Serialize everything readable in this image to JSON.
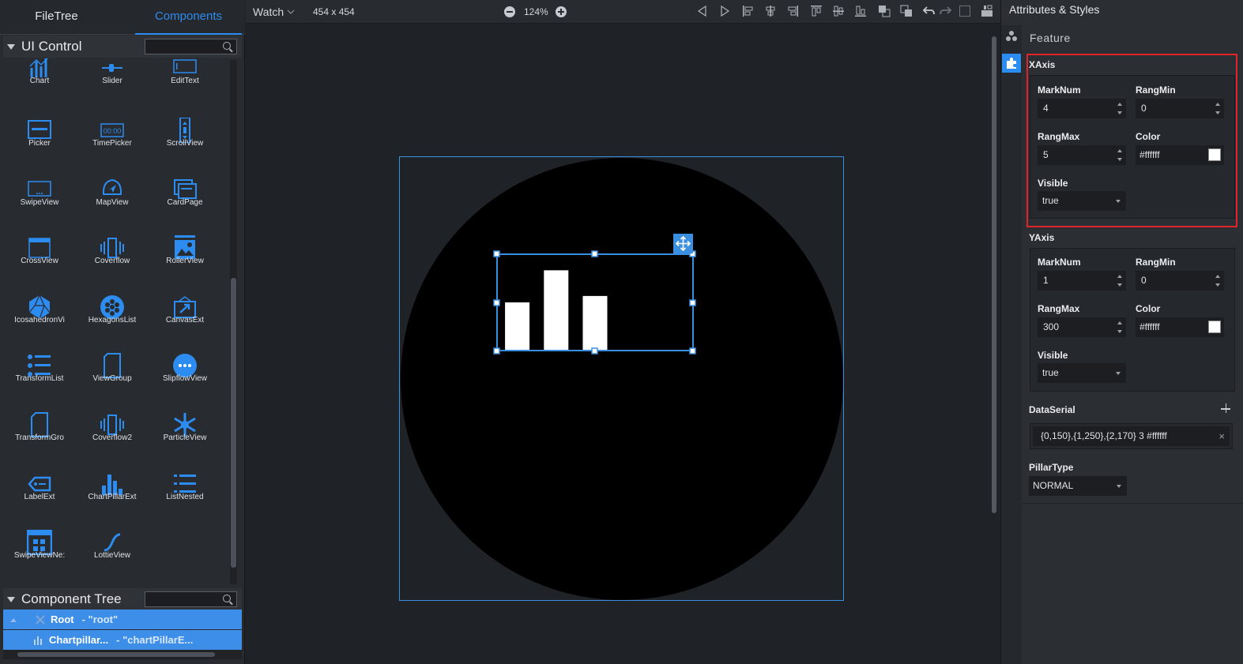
{
  "left_panel": {
    "tabs": [
      {
        "label": "FileTree"
      },
      {
        "label": "Components"
      }
    ],
    "ui_control": {
      "title": "UI Control",
      "search_placeholder": ""
    },
    "components": [
      {
        "label": "Chart",
        "icon": "chart-icon"
      },
      {
        "label": "Slider",
        "icon": "slider-icon"
      },
      {
        "label": "EditText",
        "icon": "edittext-icon"
      },
      {
        "label": "Picker",
        "icon": "picker-icon"
      },
      {
        "label": "TimePicker",
        "icon": "timepicker-icon"
      },
      {
        "label": "ScrollView",
        "icon": "scrollview-icon"
      },
      {
        "label": "SwipeView",
        "icon": "swipeview-icon"
      },
      {
        "label": "MapView",
        "icon": "mapview-icon"
      },
      {
        "label": "CardPage",
        "icon": "cardpage-icon"
      },
      {
        "label": "CrossView",
        "icon": "crossview-icon"
      },
      {
        "label": "Coverflow",
        "icon": "coverflow-icon"
      },
      {
        "label": "RollerView",
        "icon": "rollerview-icon"
      },
      {
        "label": "IcosahedronVi",
        "icon": "icosahedron-icon"
      },
      {
        "label": "HexagonsList",
        "icon": "hexagons-icon"
      },
      {
        "label": "CanvasExt",
        "icon": "canvasext-icon"
      },
      {
        "label": "TransformList",
        "icon": "transformlist-icon"
      },
      {
        "label": "ViewGroup",
        "icon": "viewgroup-icon"
      },
      {
        "label": "SlipflowView",
        "icon": "slipflow-icon"
      },
      {
        "label": "TransformGro",
        "icon": "transformgroup-icon"
      },
      {
        "label": "Coverflow2",
        "icon": "coverflow2-icon"
      },
      {
        "label": "ParticleView",
        "icon": "particle-icon"
      },
      {
        "label": "LabelExt",
        "icon": "labelext-icon"
      },
      {
        "label": "ChartPillarExt",
        "icon": "chartpillar-icon"
      },
      {
        "label": "ListNested",
        "icon": "listnested-icon"
      },
      {
        "label": "SwipeViewNe:",
        "icon": "swipeviewnested-icon"
      },
      {
        "label": "LottieView",
        "icon": "lottie-icon"
      }
    ],
    "component_tree": {
      "title": "Component Tree",
      "rows": [
        {
          "name": "Root",
          "id": "- \"root\""
        },
        {
          "name": "Chartpillar...",
          "id": "- \"chartPillarE..."
        }
      ]
    }
  },
  "toolbar": {
    "device": "Watch",
    "resolution": "454 x 454",
    "zoom": "124%"
  },
  "chart_data": {
    "type": "bar",
    "categories": [
      "0",
      "1",
      "2"
    ],
    "values": [
      150,
      250,
      170
    ],
    "ylim": [
      0,
      300
    ],
    "xlim": [
      0,
      5
    ],
    "bar_color": "#ffffff",
    "background": "#000000"
  },
  "right_panel": {
    "title": "Attributes & Styles",
    "section": "Feature",
    "xaxis": {
      "title": "XAxis",
      "marknum_label": "MarkNum",
      "marknum": "4",
      "rangmin_label": "RangMin",
      "rangmin": "0",
      "rangmax_label": "RangMax",
      "rangmax": "5",
      "color_label": "Color",
      "color": "#ffffff",
      "visible_label": "Visible",
      "visible": "true"
    },
    "yaxis": {
      "title": "YAxis",
      "marknum_label": "MarkNum",
      "marknum": "1",
      "rangmin_label": "RangMin",
      "rangmin": "0",
      "rangmax_label": "RangMax",
      "rangmax": "300",
      "color_label": "Color",
      "color": "#ffffff",
      "visible_label": "Visible",
      "visible": "true"
    },
    "dataserial": {
      "title": "DataSerial",
      "value": "{0,150},{1,250},{2,170} 3 #ffffff",
      "remove": "×"
    },
    "pillartype": {
      "title": "PillarType",
      "value": "NORMAL"
    }
  },
  "colors": {
    "accent": "#2d8cf0",
    "highlight": "#e0242a",
    "selection": "#3d8ee8"
  }
}
